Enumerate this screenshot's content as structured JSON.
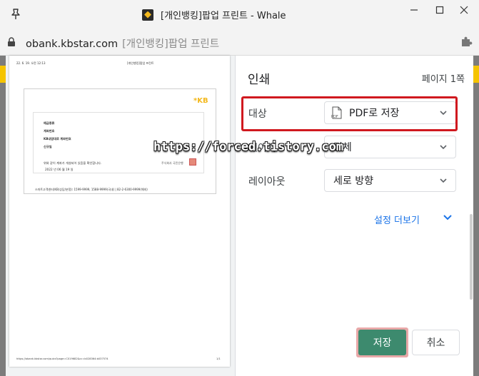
{
  "window": {
    "title": "[개인뱅킹]팝업 프린트 - Whale",
    "controls": [
      "minimize",
      "maximize",
      "close"
    ]
  },
  "address": {
    "host": "obank.kbstar.com",
    "page_title": "[개인뱅킹]팝업 프린트"
  },
  "preview": {
    "header_left": "22. 6. 19. 오전 12:13",
    "header_mid": "[개인뱅킹]팝업 프린트",
    "doc_logo": "*KB",
    "lines": [
      "예금종류",
      "계좌번호",
      "KB내맘대로 계좌번호",
      "신규일"
    ],
    "body_line1": "위와 같이 계좌가 개설되어 있음을 확인합니다.",
    "body_line2": "2022 년 06 월 19 일",
    "stamp_label": "주식회사 국민은행",
    "footer": "스마트고객센터(KB(상담/분쟁): 1599-9999, 1588-9999(국내) | 82-2-6300-9999(해외)",
    "footer_url": "https://obank.kbstar.com/quics?page=C019682&cc=b028364:b037574",
    "page_num": "1/1"
  },
  "watermark": "https://forced.tistory.com",
  "settings": {
    "title": "인쇄",
    "page_count": "페이지 1쪽",
    "destination_label": "대상",
    "destination_value": "PDF로 저장",
    "pdf_icon_text": "PDF",
    "pages_label": "페이지",
    "pages_value": "전체",
    "layout_label": "레이아웃",
    "layout_value": "세로 방향",
    "more_settings": "설정 더보기",
    "save_button": "저장",
    "cancel_button": "취소"
  },
  "colors": {
    "save_button": "#3d8a6e",
    "highlight_box": "#d0191f",
    "link": "#1a73e8"
  }
}
